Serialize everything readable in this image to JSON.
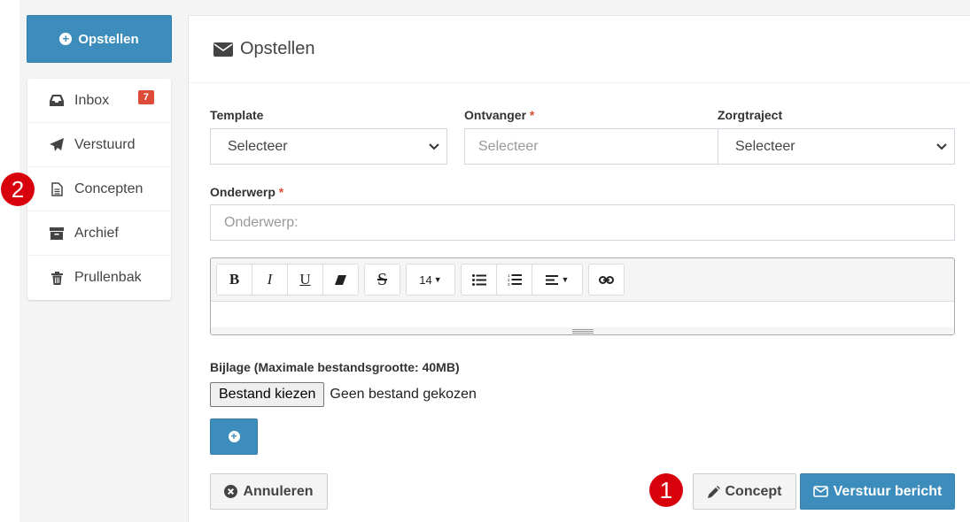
{
  "compose_button": {
    "label": "Opstellen"
  },
  "folders": [
    {
      "label": "Inbox",
      "icon": "inbox-icon",
      "badge": "7"
    },
    {
      "label": "Verstuurd",
      "icon": "paper-plane-icon"
    },
    {
      "label": "Concepten",
      "icon": "file-text-icon"
    },
    {
      "label": "Archief",
      "icon": "archive-icon"
    },
    {
      "label": "Prullenbak",
      "icon": "trash-icon"
    }
  ],
  "form": {
    "title": "Opstellen",
    "template": {
      "label": "Template",
      "value": "Selecteer"
    },
    "recipient": {
      "label": "Ontvanger",
      "required_mark": "*",
      "placeholder": "Selecteer"
    },
    "care_path": {
      "label": "Zorgtraject",
      "value": "Selecteer"
    },
    "subject": {
      "label": "Onderwerp",
      "required_mark": "*",
      "placeholder": "Onderwerp:"
    },
    "editor": {
      "font_size": "14"
    },
    "attachment": {
      "label": "Bijlage (Maximale bestandsgrootte: 40MB)",
      "choose_button": "Bestand kiezen",
      "status": "Geen bestand gekozen"
    },
    "cancel_button": "Annuleren",
    "draft_button": "Concept",
    "send_button": "Verstuur bericht"
  },
  "annotations": {
    "marker_1": "1",
    "marker_2": "2"
  },
  "colors": {
    "primary": "#3c8dbc",
    "danger": "#dd4b39",
    "marker": "#d9000d"
  }
}
